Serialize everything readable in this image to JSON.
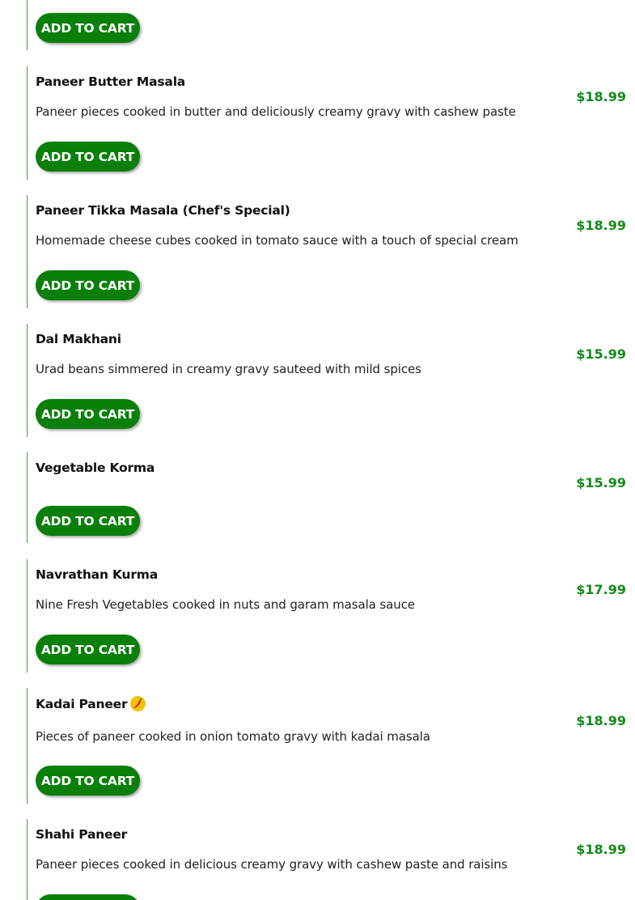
{
  "menu": {
    "button_label": "ADD TO CART",
    "items": [
      {
        "name": "",
        "description": "",
        "price": ""
      },
      {
        "name": "Paneer Butter Masala",
        "description": "Paneer pieces cooked in butter and deliciously creamy gravy with cashew paste",
        "price": "$18.99"
      },
      {
        "name": "Paneer Tikka Masala (Chef's Special)",
        "description": "Homemade cheese cubes cooked in tomato sauce with a touch of special cream",
        "price": "$18.99"
      },
      {
        "name": "Dal Makhani",
        "description": "Urad beans simmered in creamy gravy sauteed with mild spices",
        "price": "$15.99"
      },
      {
        "name": "Vegetable Korma",
        "description": "",
        "price": "$15.99"
      },
      {
        "name": "Navrathan Kurma",
        "description": "Nine Fresh Vegetables cooked in nuts and garam masala sauce",
        "price": "$17.99"
      },
      {
        "name": "Kadai Paneer",
        "description": "Pieces of paneer cooked in onion tomato gravy with kadai masala",
        "price": "$18.99",
        "icon": "chili-pepper-icon"
      },
      {
        "name": "Shahi Paneer",
        "description": "Paneer pieces cooked in delicious creamy gravy with cashew paste and raisins",
        "price": "$18.99"
      }
    ]
  },
  "colors": {
    "button_green": "#0a7f0a",
    "price_green": "#138a1a",
    "divider_green": "#4a9a4a",
    "spicy_badge": "#f4c20d",
    "chili_red": "#d62a12"
  }
}
